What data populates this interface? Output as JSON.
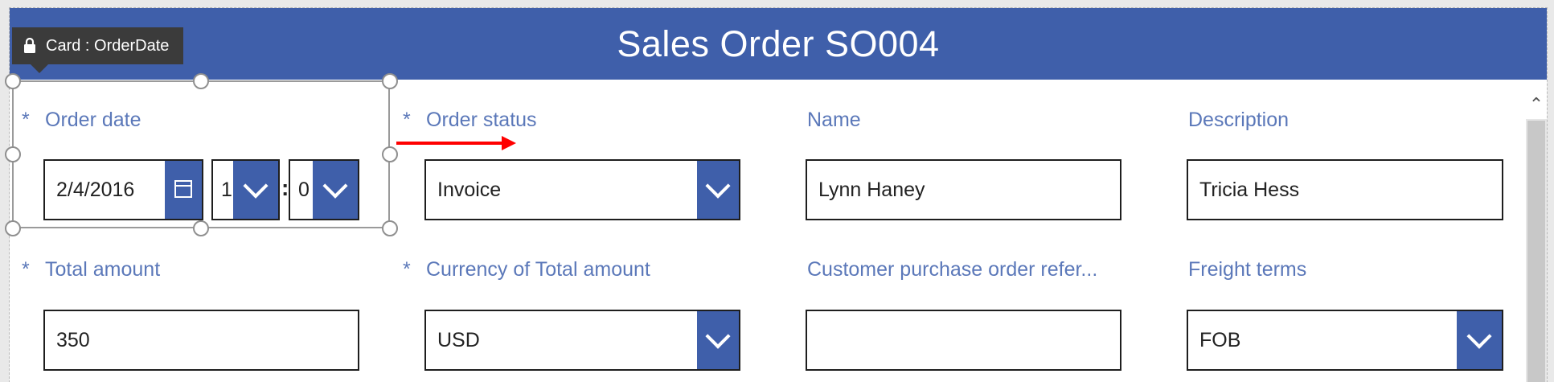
{
  "screen": {
    "title": "Sales Order SO004"
  },
  "selection": {
    "tooltip_label": "Card : OrderDate",
    "lock_icon": "lock-icon"
  },
  "form": {
    "required_marker": "*",
    "order_date": {
      "label": "Order date",
      "required": true,
      "date_value": "2/4/2016",
      "hour_value": "1",
      "minute_value": "0",
      "time_separator": ":",
      "calendar_icon": "calendar-icon"
    },
    "order_status": {
      "label": "Order status",
      "required": true,
      "value": "Invoice"
    },
    "name": {
      "label": "Name",
      "value": "Lynn Haney"
    },
    "description": {
      "label": "Description",
      "value": "Tricia Hess"
    },
    "total_amount": {
      "label": "Total amount",
      "required": true,
      "value": "350"
    },
    "currency": {
      "label": "Currency of Total amount",
      "required": true,
      "value": "USD"
    },
    "customer_po": {
      "label": "Customer purchase order refer...",
      "value": ""
    },
    "freight_terms": {
      "label": "Freight terms",
      "value": "FOB"
    }
  },
  "annotation": {
    "arrow_color": "#ff0000",
    "arrow_direction": "right"
  },
  "colors": {
    "header": "#3f5faa",
    "label": "#5b78b9",
    "dropdown_button": "#3f5faa"
  }
}
